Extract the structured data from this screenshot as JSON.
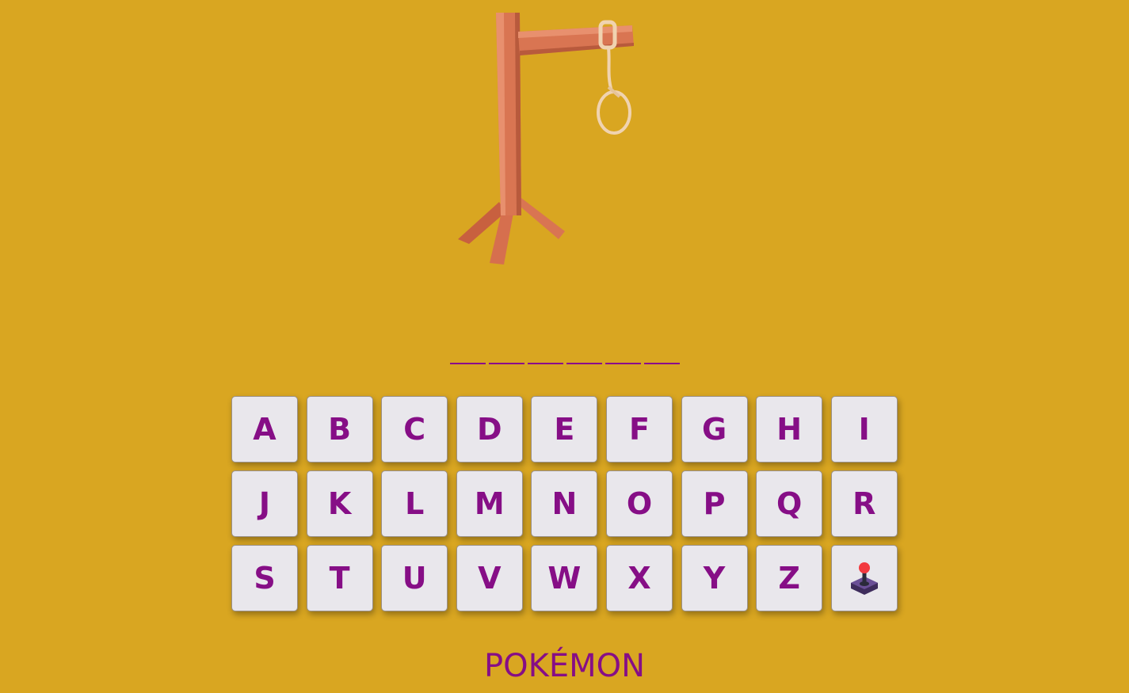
{
  "game": {
    "slot_count": 6,
    "category": "POKÉMON"
  },
  "keyboard": {
    "keys": [
      "A",
      "B",
      "C",
      "D",
      "E",
      "F",
      "G",
      "H",
      "I",
      "J",
      "K",
      "L",
      "M",
      "N",
      "O",
      "P",
      "Q",
      "R",
      "S",
      "T",
      "U",
      "V",
      "W",
      "X",
      "Y",
      "Z"
    ],
    "extra_key_icon": "joystick-icon"
  },
  "colors": {
    "background": "#d9a621",
    "accent": "#860e86",
    "key_face": "#e9e7ec",
    "wood": "#d97552",
    "rope": "#f0d3b0"
  }
}
